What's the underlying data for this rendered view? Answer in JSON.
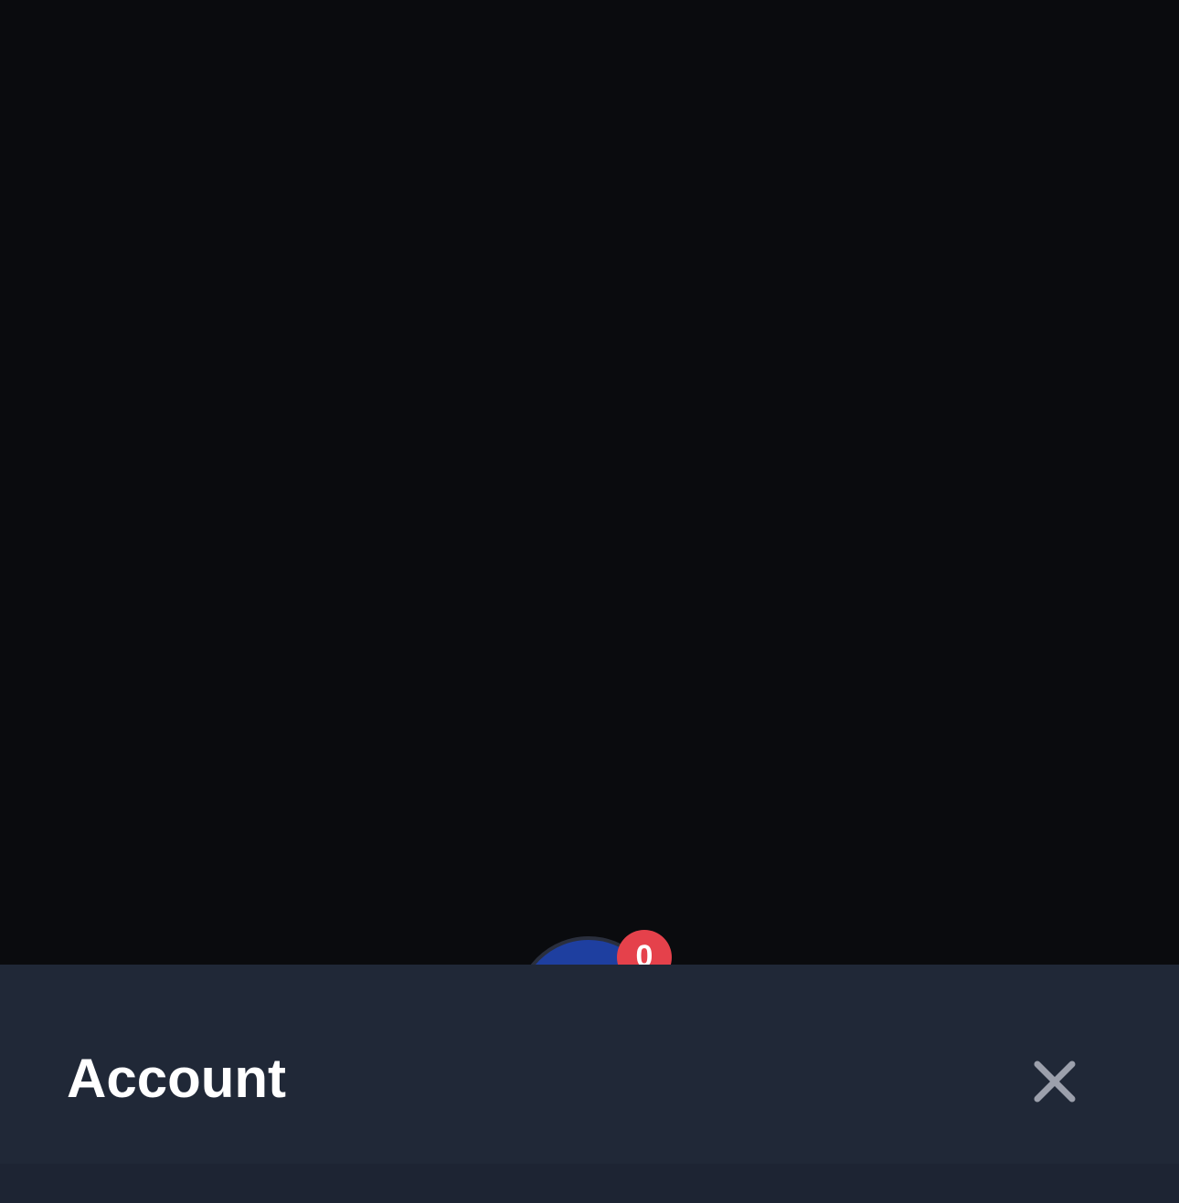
{
  "sheet": {
    "title": "Account",
    "close_icon": "close-icon"
  },
  "fab": {
    "badge_count": "0"
  },
  "colors": {
    "background": "#0a0b0e",
    "sheet": "#202837",
    "fab": "#1e3fa0",
    "badge": "#e5414b",
    "close_icon": "#9ca0ac"
  }
}
